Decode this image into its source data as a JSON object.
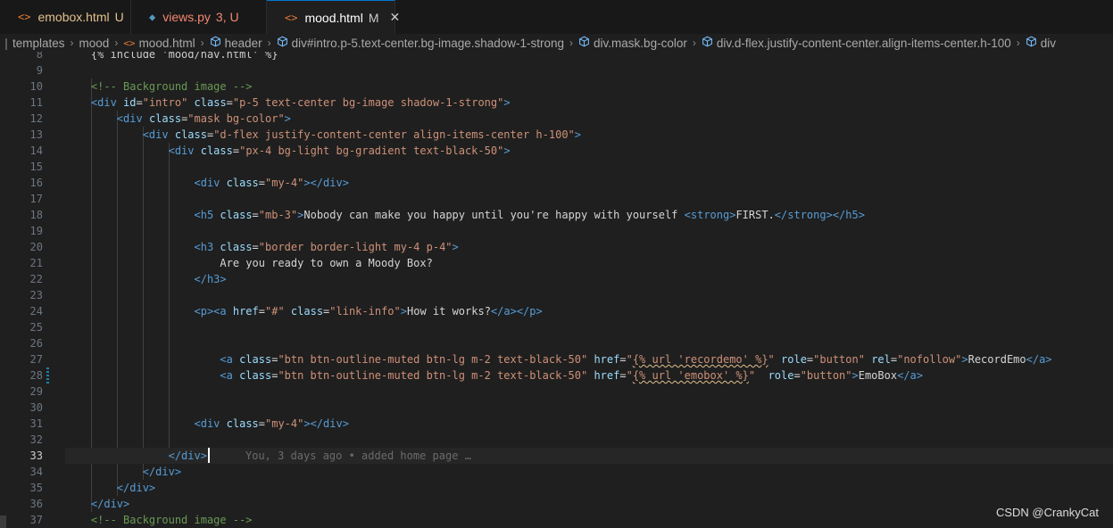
{
  "tabs": [
    {
      "icon": "html-file-icon",
      "glyph": "<>",
      "label": "emobox.html",
      "status": "U",
      "kind": "mod",
      "active": false
    },
    {
      "icon": "python-file-icon",
      "glyph": "◆",
      "label": "views.py",
      "status": "3, U",
      "kind": "err",
      "active": false
    },
    {
      "icon": "html-file-icon",
      "glyph": "<>",
      "label": "mood.html",
      "status": "M",
      "kind": "active",
      "active": true,
      "close": "✕"
    }
  ],
  "breadcrumb": {
    "items": [
      {
        "label": "templates",
        "icon": ""
      },
      {
        "label": "mood",
        "icon": ""
      },
      {
        "label": "mood.html",
        "icon": "html"
      },
      {
        "label": "header",
        "icon": "element"
      },
      {
        "label": "div#intro.p-5.text-center.bg-image.shadow-1-strong",
        "icon": "element"
      },
      {
        "label": "div.mask.bg-color",
        "icon": "element"
      },
      {
        "label": "div.d-flex.justify-content-center.align-items-center.h-100",
        "icon": "element"
      },
      {
        "label": "div",
        "icon": "element"
      }
    ]
  },
  "editor": {
    "current_line": 33,
    "blame": "You, 3 days ago • added home page …",
    "lines": [
      {
        "n": 8,
        "tokens": [
          [
            "tpl",
            "    {% include 'mood/nav.html' %}"
          ]
        ]
      },
      {
        "n": 9,
        "tokens": []
      },
      {
        "n": 10,
        "tokens": [
          [
            "com",
            "    <!-- Background image -->"
          ]
        ]
      },
      {
        "n": 11,
        "tokens": [
          [
            "text",
            "    "
          ],
          [
            "tag",
            "<div"
          ],
          [
            "text",
            " "
          ],
          [
            "attr",
            "id"
          ],
          [
            "text",
            "="
          ],
          [
            "str",
            "\"intro\""
          ],
          [
            "text",
            " "
          ],
          [
            "attr",
            "class"
          ],
          [
            "text",
            "="
          ],
          [
            "str",
            "\"p-5 text-center bg-image shadow-1-strong\""
          ],
          [
            "tag",
            ">"
          ]
        ]
      },
      {
        "n": 12,
        "tokens": [
          [
            "text",
            "        "
          ],
          [
            "tag",
            "<div"
          ],
          [
            "text",
            " "
          ],
          [
            "attr",
            "class"
          ],
          [
            "text",
            "="
          ],
          [
            "str",
            "\"mask bg-color\""
          ],
          [
            "tag",
            ">"
          ]
        ]
      },
      {
        "n": 13,
        "tokens": [
          [
            "text",
            "            "
          ],
          [
            "tag",
            "<div"
          ],
          [
            "text",
            " "
          ],
          [
            "attr",
            "class"
          ],
          [
            "text",
            "="
          ],
          [
            "str",
            "\"d-flex justify-content-center align-items-center h-100\""
          ],
          [
            "tag",
            ">"
          ]
        ]
      },
      {
        "n": 14,
        "tokens": [
          [
            "text",
            "                "
          ],
          [
            "tag",
            "<div"
          ],
          [
            "text",
            " "
          ],
          [
            "attr",
            "class"
          ],
          [
            "text",
            "="
          ],
          [
            "str",
            "\"px-4 bg-light bg-gradient text-black-50\""
          ],
          [
            "tag",
            ">"
          ]
        ]
      },
      {
        "n": 15,
        "tokens": []
      },
      {
        "n": 16,
        "tokens": [
          [
            "text",
            "                    "
          ],
          [
            "tag",
            "<div"
          ],
          [
            "text",
            " "
          ],
          [
            "attr",
            "class"
          ],
          [
            "text",
            "="
          ],
          [
            "str",
            "\"my-4\""
          ],
          [
            "tag",
            "></div>"
          ]
        ]
      },
      {
        "n": 17,
        "tokens": []
      },
      {
        "n": 18,
        "tokens": [
          [
            "text",
            "                    "
          ],
          [
            "tag",
            "<h5"
          ],
          [
            "text",
            " "
          ],
          [
            "attr",
            "class"
          ],
          [
            "text",
            "="
          ],
          [
            "str",
            "\"mb-3\""
          ],
          [
            "tag",
            ">"
          ],
          [
            "text",
            "Nobody can make you happy until you're happy with yourself "
          ],
          [
            "tag",
            "<strong>"
          ],
          [
            "text",
            "FIRST."
          ],
          [
            "tag",
            "</strong></h5>"
          ]
        ]
      },
      {
        "n": 19,
        "tokens": []
      },
      {
        "n": 20,
        "tokens": [
          [
            "text",
            "                    "
          ],
          [
            "tag",
            "<h3"
          ],
          [
            "text",
            " "
          ],
          [
            "attr",
            "class"
          ],
          [
            "text",
            "="
          ],
          [
            "str",
            "\"border border-light my-4 p-4\""
          ],
          [
            "tag",
            ">"
          ]
        ]
      },
      {
        "n": 21,
        "tokens": [
          [
            "text",
            "                        Are you ready to own a Moody Box?"
          ]
        ]
      },
      {
        "n": 22,
        "tokens": [
          [
            "text",
            "                    "
          ],
          [
            "tag",
            "</h3>"
          ]
        ]
      },
      {
        "n": 23,
        "tokens": []
      },
      {
        "n": 24,
        "tokens": [
          [
            "text",
            "                    "
          ],
          [
            "tag",
            "<p><a"
          ],
          [
            "text",
            " "
          ],
          [
            "attr",
            "href"
          ],
          [
            "text",
            "="
          ],
          [
            "str",
            "\"#\""
          ],
          [
            "text",
            " "
          ],
          [
            "attr",
            "class"
          ],
          [
            "text",
            "="
          ],
          [
            "str",
            "\"link-info\""
          ],
          [
            "tag",
            ">"
          ],
          [
            "text",
            "How it works?"
          ],
          [
            "tag",
            "</a></p>"
          ]
        ]
      },
      {
        "n": 25,
        "tokens": []
      },
      {
        "n": 26,
        "tokens": []
      },
      {
        "n": 27,
        "tokens": [
          [
            "text",
            "                        "
          ],
          [
            "tag",
            "<a"
          ],
          [
            "text",
            " "
          ],
          [
            "attr",
            "class"
          ],
          [
            "text",
            "="
          ],
          [
            "str",
            "\"btn btn-outline-muted btn-lg m-2 text-black-50\""
          ],
          [
            "text",
            " "
          ],
          [
            "attr",
            "href"
          ],
          [
            "text",
            "="
          ],
          [
            "str",
            "\""
          ],
          [
            "err",
            "{% url 'recordemo' %}"
          ],
          [
            "str",
            "\""
          ],
          [
            "text",
            " "
          ],
          [
            "attr",
            "role"
          ],
          [
            "text",
            "="
          ],
          [
            "str",
            "\"button\""
          ],
          [
            "text",
            " "
          ],
          [
            "attr",
            "rel"
          ],
          [
            "text",
            "="
          ],
          [
            "str",
            "\"nofollow\""
          ],
          [
            "tag",
            ">"
          ],
          [
            "text",
            "RecordEmo"
          ],
          [
            "tag",
            "</a>"
          ]
        ]
      },
      {
        "n": 28,
        "tokens": [
          [
            "text",
            "                        "
          ],
          [
            "tag",
            "<a"
          ],
          [
            "text",
            " "
          ],
          [
            "attr",
            "class"
          ],
          [
            "text",
            "="
          ],
          [
            "str",
            "\"btn btn-outline-muted btn-lg m-2 text-black-50\""
          ],
          [
            "text",
            " "
          ],
          [
            "attr",
            "href"
          ],
          [
            "text",
            "="
          ],
          [
            "str",
            "\""
          ],
          [
            "err",
            "{% url 'emobox' %}"
          ],
          [
            "str",
            "\""
          ],
          [
            "text",
            "  "
          ],
          [
            "attr",
            "role"
          ],
          [
            "text",
            "="
          ],
          [
            "str",
            "\"button\""
          ],
          [
            "tag",
            ">"
          ],
          [
            "text",
            "EmoBox"
          ],
          [
            "tag",
            "</a>"
          ]
        ]
      },
      {
        "n": 29,
        "tokens": []
      },
      {
        "n": 30,
        "tokens": []
      },
      {
        "n": 31,
        "tokens": [
          [
            "text",
            "                    "
          ],
          [
            "tag",
            "<div"
          ],
          [
            "text",
            " "
          ],
          [
            "attr",
            "class"
          ],
          [
            "text",
            "="
          ],
          [
            "str",
            "\"my-4\""
          ],
          [
            "tag",
            "></div>"
          ]
        ]
      },
      {
        "n": 32,
        "tokens": []
      },
      {
        "n": 33,
        "tokens": [
          [
            "text",
            "                "
          ],
          [
            "tag",
            "</div>"
          ]
        ]
      },
      {
        "n": 34,
        "tokens": [
          [
            "text",
            "            "
          ],
          [
            "tag",
            "</div>"
          ]
        ]
      },
      {
        "n": 35,
        "tokens": [
          [
            "text",
            "        "
          ],
          [
            "tag",
            "</div>"
          ]
        ]
      },
      {
        "n": 36,
        "tokens": [
          [
            "text",
            "    "
          ],
          [
            "tag",
            "</div>"
          ]
        ]
      },
      {
        "n": 37,
        "tokens": [
          [
            "com",
            "    <!-- Background image -->"
          ]
        ]
      }
    ]
  },
  "watermark": "CSDN @CrankyCat",
  "colors": {
    "tag": "#569cd6",
    "attr": "#9cdcfe",
    "string": "#ce9178",
    "comment": "#6a9955",
    "accent": "#0078d4"
  }
}
